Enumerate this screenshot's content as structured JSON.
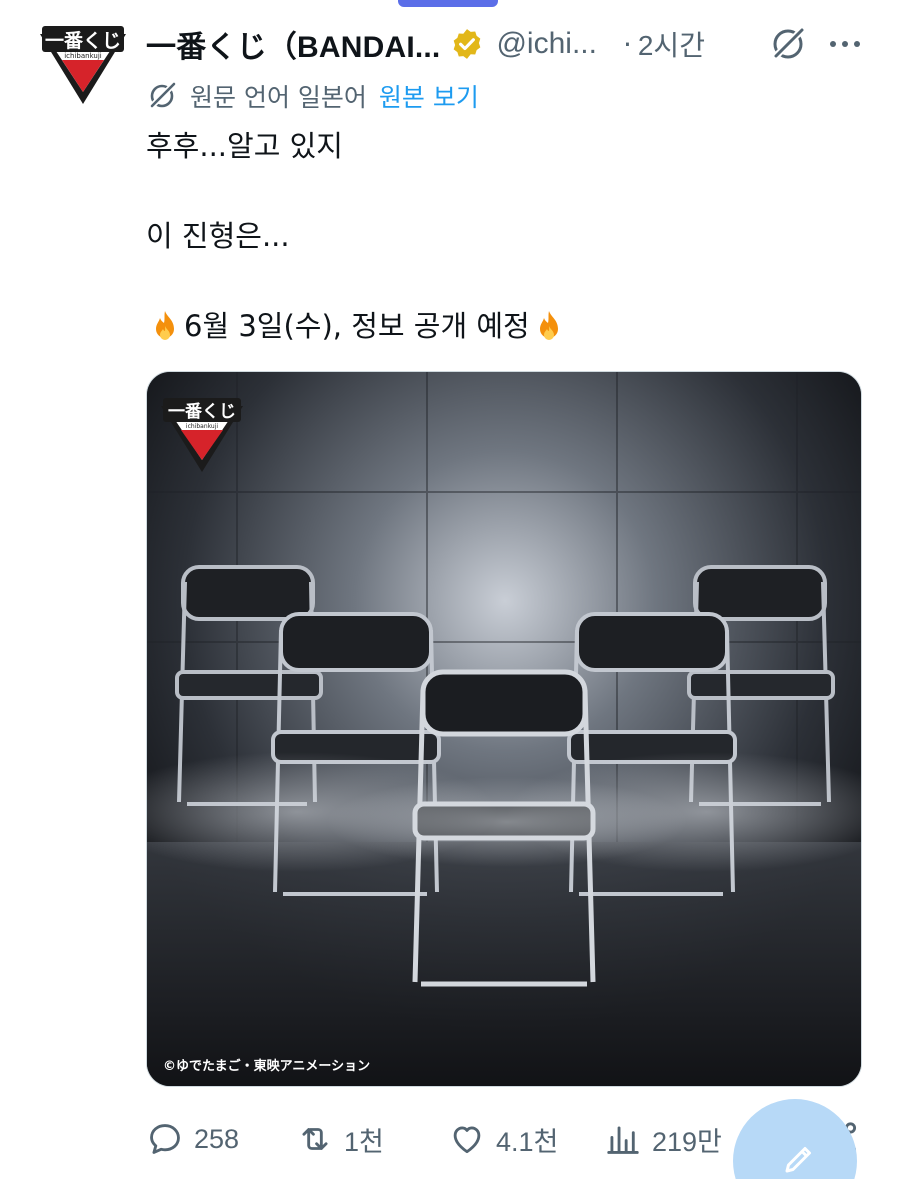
{
  "tweet": {
    "author_name": "一番くじ（BANDAI...",
    "handle": "@ichi...",
    "separator": "·",
    "time": "2시간",
    "translation_note": "원문 언어 일본어",
    "show_original_label": "원본 보기",
    "text_lines": [
      "후후...알고 있지",
      "",
      "이 진형은...",
      "",
      "6월 3일(수), 정보 공개 예정"
    ],
    "media": {
      "copyright": "©ゆでたまご・東映アニメーション",
      "logo_text": "一番くじ",
      "logo_subtext": "ichibankuji"
    }
  },
  "avatar": {
    "logo_text": "一番くじ",
    "logo_subtext": "ichibankuji"
  },
  "actions": {
    "replies": "258",
    "reposts": "1천",
    "likes": "4.1천",
    "views": "219만"
  },
  "icons": {
    "verified": "verified-badge-icon",
    "grok": "grok-icon",
    "more": "more-icon",
    "translate": "translate-icon",
    "reply": "reply-icon",
    "repost": "repost-icon",
    "like": "heart-icon",
    "views": "views-icon",
    "bookmark": "bookmark-icon",
    "share": "share-icon",
    "compose": "compose-icon",
    "fire": "fire-emoji-icon"
  },
  "colors": {
    "accent": "#1d9bf0",
    "secondary_text": "#536471",
    "verified_gold": "#e2b719",
    "fab": "#b7d9f7"
  }
}
